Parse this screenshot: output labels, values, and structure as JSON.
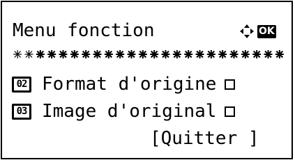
{
  "screen": {
    "title": "Menu fonction",
    "ok_label": "OK"
  },
  "items": [
    {
      "number": "02",
      "label": "Format d'origine"
    },
    {
      "number": "03",
      "label": "Image d'original"
    }
  ],
  "footer": {
    "quit_label": "[Quitter ]"
  },
  "colors": {
    "foreground": "#000000",
    "background": "#ffffff"
  },
  "icons": {
    "navigation": "four-way-arrow-icon",
    "checkbox": "empty-checkbox-icon"
  }
}
